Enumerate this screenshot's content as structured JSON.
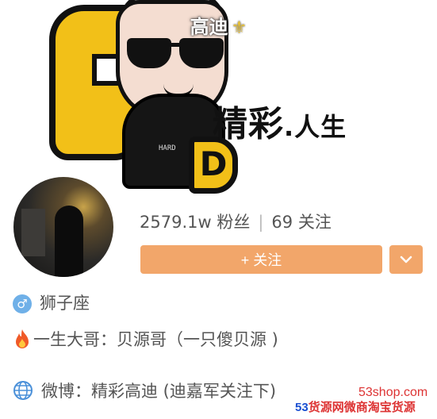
{
  "header": {
    "title": "高迪",
    "title_symbol": "⚜",
    "banner_slogan_main": "精彩",
    "banner_slogan_small": ".人生",
    "banner_letter_d": "D",
    "banner_hoodie_print": "HARD"
  },
  "profile": {
    "followers_label": "2579.1w 粉丝",
    "following_label": "69 关注",
    "follow_button": "+ 关注"
  },
  "info": {
    "gender_symbol": "♂",
    "zodiac": "狮子座",
    "bio": "一生大哥：贝源哥（一只傻贝源 )",
    "weibo": "微博：精彩高迪 (迪嘉军关注下)"
  },
  "watermark": {
    "site": "53shop.com",
    "number": "53",
    "brand": "货源网",
    "brand_tail": "微商淘宝货源"
  },
  "colors": {
    "accent": "#f2a66a",
    "banner_yellow": "#f2c018"
  }
}
